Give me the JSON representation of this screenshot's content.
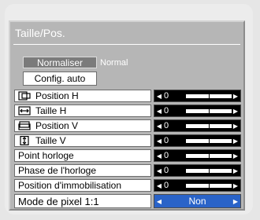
{
  "window": {
    "title": "Taille/Pos."
  },
  "normalize": {
    "button_label": "Normaliser",
    "status": "Normal"
  },
  "auto_config": {
    "label": "Config. auto"
  },
  "settings": [
    {
      "label": "Position H",
      "icon": "horizontal-position-icon",
      "value": "0",
      "level": 0.5
    },
    {
      "label": "Taille H",
      "icon": "horizontal-size-icon",
      "value": "0",
      "level": 0.5
    },
    {
      "label": "Position V",
      "icon": "vertical-position-icon",
      "value": "0",
      "level": 0.5
    },
    {
      "label": "Taille V",
      "icon": "vertical-size-icon",
      "value": "0",
      "level": 0.5
    },
    {
      "label": "Point horloge",
      "icon": "",
      "value": "0",
      "level": 0.5
    },
    {
      "label": "Phase de l'horloge",
      "icon": "",
      "value": "0",
      "level": 0.5
    },
    {
      "label": "Position d'immobilisation",
      "icon": "",
      "value": "0",
      "level": 0.5
    }
  ],
  "pixel_mode": {
    "label": "Mode de pixel 1:1",
    "value": "Non"
  },
  "colors": {
    "osd_background": "#b6b6b6",
    "control_background": "#000000",
    "selected_control": "#2a63c8",
    "normalize_button": "#7b7b7b"
  }
}
